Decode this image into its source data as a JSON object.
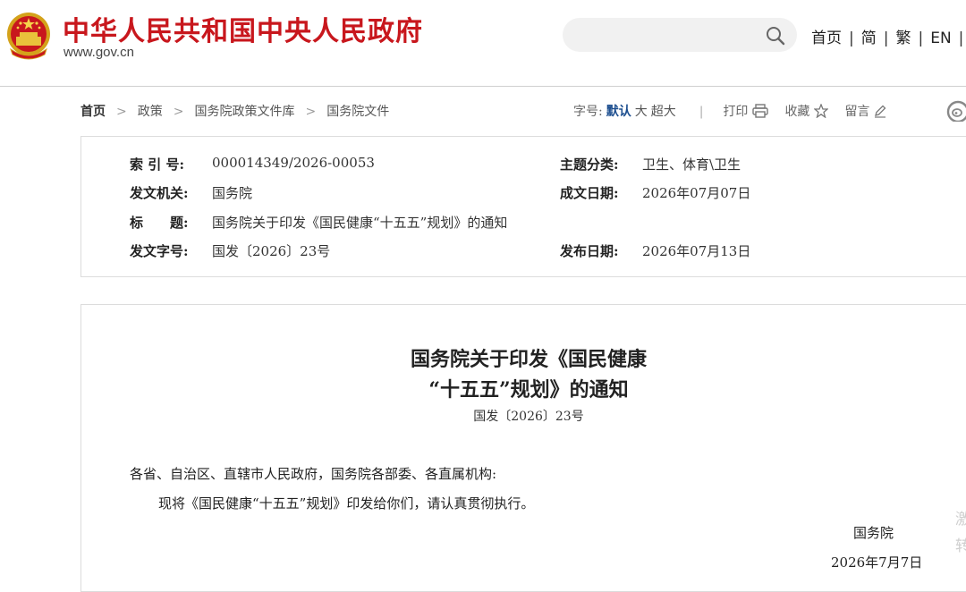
{
  "header": {
    "site_title": "中华人民共和国中央人民政府",
    "site_domain": "www.gov.cn",
    "search_placeholder": "",
    "nav": [
      "首页",
      "简",
      "繁",
      "EN"
    ],
    "nav_separator": "|"
  },
  "breadcrumb": {
    "items": [
      "首页",
      "政策",
      "国务院政策文件库",
      "国务院文件"
    ],
    "arrow": ">"
  },
  "toolbar": {
    "font_size_label": "字号:",
    "sizes": [
      "默认",
      "大",
      "超大"
    ],
    "active_size": "默认",
    "divider": "|",
    "print_label": "打印",
    "favorite_label": "收藏",
    "comment_label": "留言"
  },
  "meta": {
    "index_no": {
      "label": "索 引 号:",
      "value": "000014349/2026-00053"
    },
    "issuer": {
      "label": "发文机关:",
      "value": "国务院"
    },
    "title": {
      "label": "标　　题:",
      "value": "国务院关于印发《国民健康“十五五”规划》的通知"
    },
    "doc_no": {
      "label": "发文字号:",
      "value": "国发〔2026〕23号"
    },
    "topic": {
      "label": "主题分类:",
      "value": "卫生、体育\\卫生"
    },
    "written_date": {
      "label": "成文日期:",
      "value": "2026年07月07日"
    },
    "publish_date": {
      "label": "发布日期:",
      "value": "2026年07月13日"
    }
  },
  "article": {
    "title_line1": "国务院关于印发《国民健康",
    "title_line2": "“十五五”规划》的通知",
    "doc_no": "国发〔2026〕23号",
    "salutation": "各省、自治区、直辖市人民政府，国务院各部委、各直属机构:",
    "body": "现将《国民健康“十五五”规划》印发给你们，请认真贯彻执行。",
    "signature": "国务院",
    "date": "2026年7月7日"
  },
  "side_float": [
    "激",
    "转"
  ],
  "colors": {
    "brand_red": "#c8171d",
    "link_blue": "#1c4e8f",
    "border": "#dcdcdc"
  },
  "icons": [
    "national-emblem-icon",
    "search-icon",
    "printer-icon",
    "star-icon",
    "pencil-icon",
    "weibo-icon"
  ]
}
